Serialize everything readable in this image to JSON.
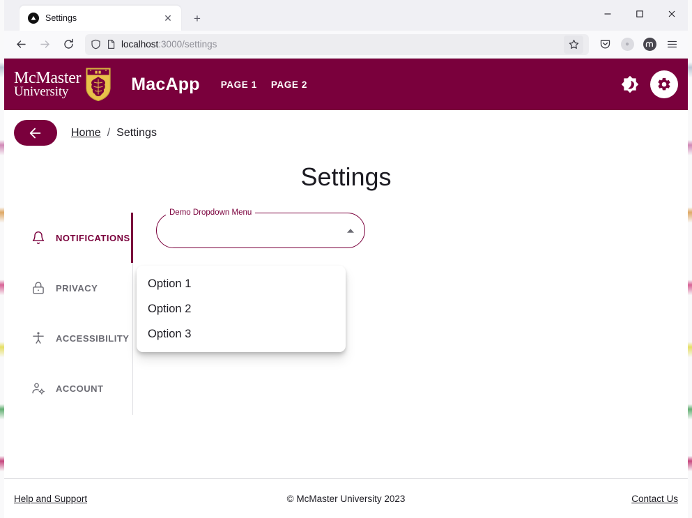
{
  "browser": {
    "tab": {
      "title": "Settings",
      "favicon": "triangle-circle-icon",
      "close_label": "✕"
    },
    "new_tab_label": "+",
    "window_controls": {
      "minimize": "–",
      "maximize": "□",
      "close": "✕"
    },
    "nav": {
      "back": "back-arrow-icon",
      "forward": "forward-arrow-icon",
      "reload": "reload-icon"
    },
    "url": {
      "host": "localhost",
      "path": ":3000/settings",
      "full": "localhost:3000/settings"
    },
    "toolbar_icons": [
      "bookmark-star-icon",
      "pocket-save-icon",
      "account-avatar-icon",
      "extension-w-icon",
      "app-menu-icon"
    ]
  },
  "app": {
    "brand": {
      "line1": "McMaster",
      "line2": "University",
      "crest": "mcmaster-crest-icon"
    },
    "title": "MacApp",
    "nav_links": [
      {
        "label": "PAGE 1"
      },
      {
        "label": "PAGE 2"
      }
    ],
    "header_icons": {
      "dark_mode": "brightness-moon-icon",
      "settings": "gear-icon"
    },
    "colors": {
      "maroon": "#7A003C",
      "text": "#1C1B22",
      "muted": "#6B6B73",
      "divider": "#DFDFE2"
    }
  },
  "breadcrumb": {
    "back_button": "back-arrow-icon",
    "items": [
      {
        "label": "Home",
        "link": true
      },
      {
        "label": "Settings",
        "link": false
      }
    ],
    "separator": "/"
  },
  "page": {
    "title": "Settings"
  },
  "sidebar": {
    "items": [
      {
        "label": "NOTIFICATIONS",
        "icon": "bell-icon",
        "active": true
      },
      {
        "label": "PRIVACY",
        "icon": "lock-icon",
        "active": false
      },
      {
        "label": "ACCESSIBILITY",
        "icon": "accessibility-icon",
        "active": false
      },
      {
        "label": "ACCOUNT",
        "icon": "person-gear-icon",
        "active": false
      }
    ]
  },
  "dropdown": {
    "label": "Demo Dropdown Menu",
    "value": "",
    "placeholder": "",
    "expanded": true,
    "arrow": "caret-up-icon",
    "options": [
      {
        "label": "Option 1"
      },
      {
        "label": "Option 2"
      },
      {
        "label": "Option 3"
      }
    ]
  },
  "footer": {
    "left_link": "Help and Support",
    "copyright": "© McMaster University 2023",
    "right_link": "Contact Us"
  }
}
